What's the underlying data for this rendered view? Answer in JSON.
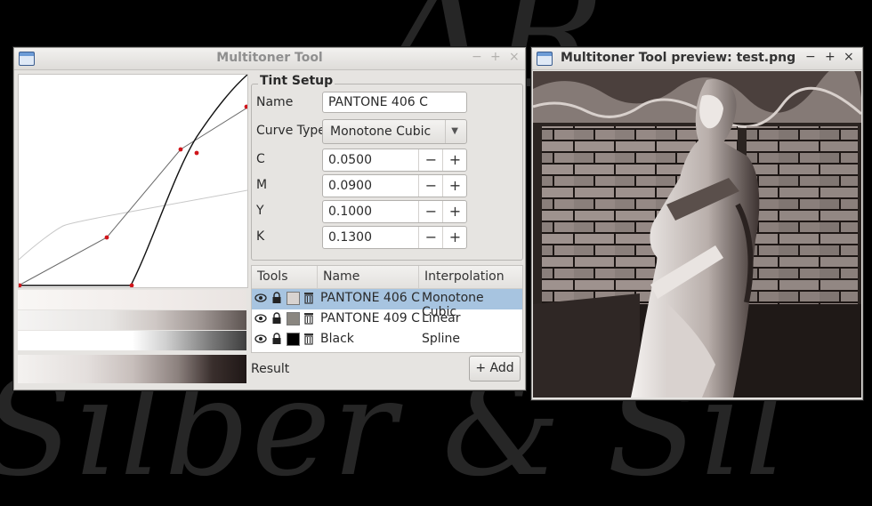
{
  "background": {
    "script_text_bottom": "Silber & Sil",
    "script_text_top": "AR"
  },
  "main_window": {
    "title": "Multitoner Tool",
    "controls": {
      "minimize": "−",
      "maximize": "+",
      "close": "×"
    },
    "tint_setup": {
      "title": "Tint Setup",
      "name_label": "Name",
      "name_value": "PANTONE 406 C",
      "curve_type_label": "Curve Type",
      "curve_type_value": "Monotone Cubic",
      "fields": [
        {
          "label": "C",
          "value": "0.0500"
        },
        {
          "label": "M",
          "value": "0.0900"
        },
        {
          "label": "Y",
          "value": "0.1000"
        },
        {
          "label": "K",
          "value": "0.1300"
        }
      ],
      "minus": "−",
      "plus": "+"
    },
    "tools_table": {
      "headers": {
        "tools": "Tools",
        "name": "Name",
        "interpolation": "Interpolation"
      },
      "rows": [
        {
          "name": "PANTONE 406 C",
          "interpolation": "Monotone Cubic",
          "swatch": "#d8d3d0",
          "selected": true
        },
        {
          "name": "PANTONE 409 C",
          "interpolation": "Linear",
          "swatch": "#8a8680",
          "selected": false
        },
        {
          "name": "Black",
          "interpolation": "Spline",
          "swatch": "#000000",
          "selected": false
        }
      ]
    },
    "result_label": "Result",
    "add_button": "+ Add"
  },
  "preview_window": {
    "title": "Multitoner Tool preview: test.png",
    "controls": {
      "minimize": "−",
      "maximize": "+",
      "close": "×"
    }
  },
  "icons": {
    "visibility": "eye-icon",
    "lock": "lock-icon",
    "delete": "trash-icon",
    "window": "window-app-icon"
  },
  "colors": {
    "selection": "#a7c4e0",
    "curve_point": "#d0151b"
  }
}
